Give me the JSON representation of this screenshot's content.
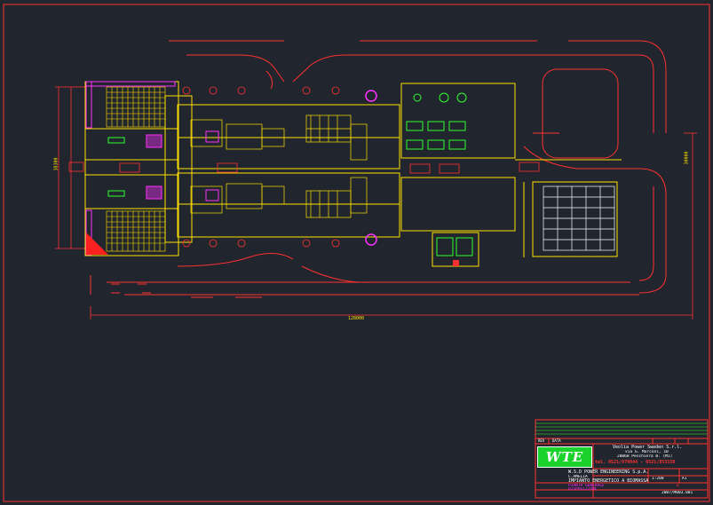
{
  "drawing": {
    "background": "#21262e",
    "colors": {
      "border": "#ff3030",
      "walls": "#ffe000",
      "roads": "#ff3030",
      "cyan": "#20d8ff",
      "green": "#30ff30",
      "magenta": "#ff30ff",
      "white": "#ffffff"
    }
  },
  "dimensions": {
    "overall_width": "128000",
    "overall_height": "38300",
    "right_height": "30000"
  },
  "title_block": {
    "company_name": "Veolia Power Sweden S.r.l.",
    "company_address": "via G. Marconi, 10",
    "company_city": "20068 Peschiera B. (MI)",
    "company_phone": "tel. 0521/979044 - 0521/853330",
    "client": "W.S.D POWER ENGINEERING S.p.A.",
    "location": "C.AMELIA",
    "project": "IMPIANTO ENERGETICO A BIOMASSA",
    "title_line1": "PIANTA GENERALE",
    "title_line2": "DISPOSIZIONE",
    "drawing_number": "2007/M003.001",
    "scale": "1:200",
    "sheet": "A1",
    "revision": "0",
    "logo_text": "WTE",
    "rev_header": "REV",
    "date_header": "DATA"
  }
}
